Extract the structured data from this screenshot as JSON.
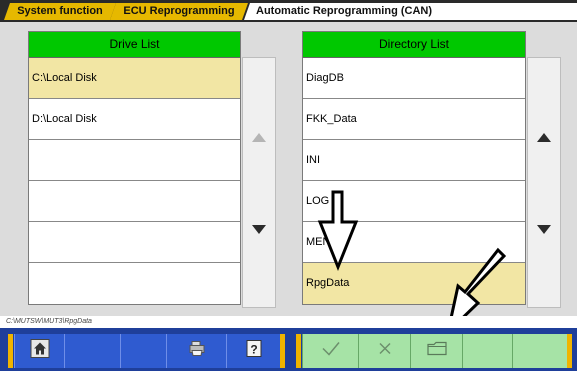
{
  "breadcrumb": {
    "items": [
      "System function",
      "ECU Reprogramming",
      "Automatic Reprogramming (CAN)"
    ]
  },
  "drive_list": {
    "header": "Drive List",
    "rows": [
      "C:\\Local Disk",
      "D:\\Local Disk",
      "",
      "",
      "",
      ""
    ],
    "selected_index": 0
  },
  "directory_list": {
    "header": "Directory List",
    "rows": [
      "DiagDB",
      "FKK_Data",
      "INI",
      "LOG",
      "MENU",
      "RpgData"
    ],
    "selected_index": 5
  },
  "status_path": "C:\\MUTSW\\MUT3\\RpgData",
  "icons": {
    "home": "home-icon",
    "printer": "printer-icon",
    "help": "help-icon",
    "ok": "check-icon",
    "cancel": "cross-icon",
    "folder": "folder-icon"
  },
  "colors": {
    "header_green": "#00c800",
    "selected_row": "#f2e6a4",
    "toolbar_blue": "#2f5bd0",
    "toolbar_green": "#a6e3a6",
    "breadcrumb_gold": "#e6b800"
  }
}
